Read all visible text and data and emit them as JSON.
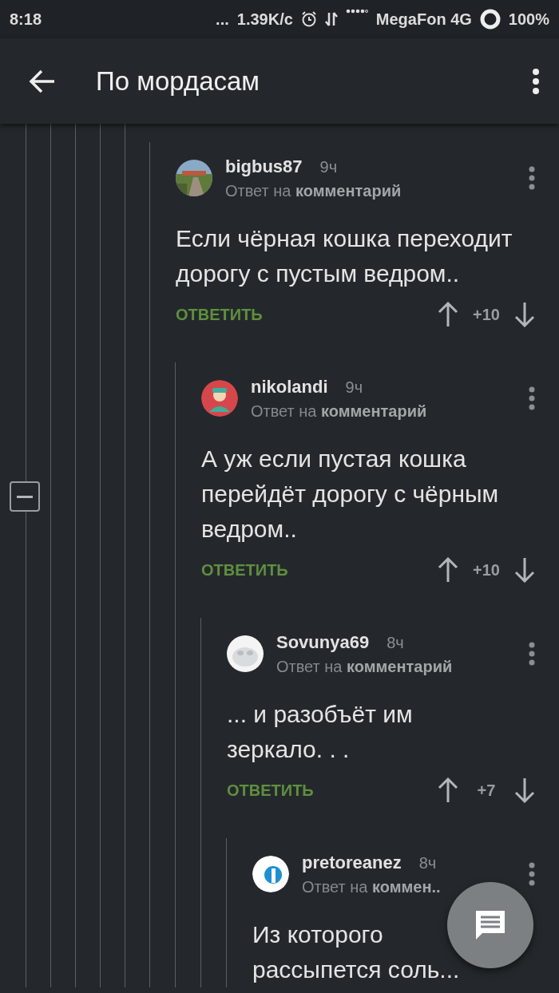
{
  "status_bar": {
    "time": "8:18",
    "more": "...",
    "speed": "1.39K/c",
    "carrier": "MegaFon 4G",
    "battery": "100%"
  },
  "app_bar": {
    "title": "По мордасам"
  },
  "comments": [
    {
      "author": "bigbus87",
      "time": "9ч",
      "reply_to": "Ответ на **комментарий**",
      "text": "Если чёрная кошка переходит дорогу с пустым ведром..",
      "reply_label": "ОТВЕТИТЬ",
      "score": "+10",
      "children": [
        {
          "author": "nikolandi",
          "time": "9ч",
          "reply_to": "Ответ на **комментарий**",
          "text": "А уж если пустая кошка перейдёт дорогу с чёрным ведром..",
          "reply_label": "ОТВЕТИТЬ",
          "score": "+10",
          "children": [
            {
              "author": "Sovunya69",
              "time": "8ч",
              "reply_to": "Ответ на **комментарий**",
              "text": "... и разобъёт им зеркало. . .",
              "reply_label": "ОТВЕТИТЬ",
              "score": "+7",
              "children": [
                {
                  "author": "pretoreanez",
                  "time": "8ч",
                  "reply_to": "Ответ на **коммен..**",
                  "text": "Из которого рассыпется соль..."
                }
              ]
            }
          ]
        }
      ]
    }
  ]
}
